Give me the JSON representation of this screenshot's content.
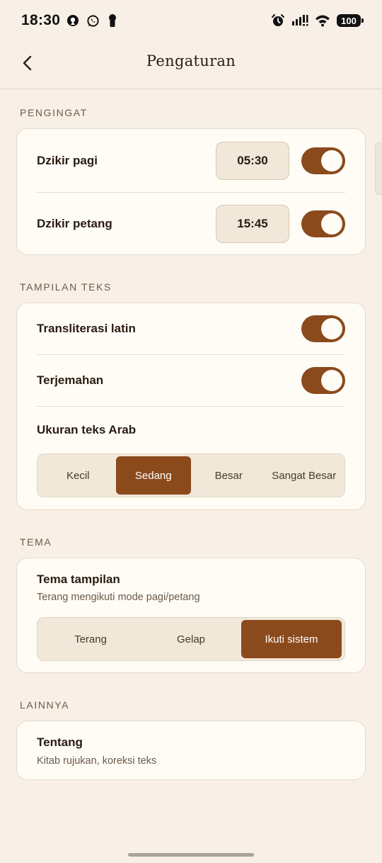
{
  "status_bar": {
    "time": "18:30",
    "battery": "100",
    "left_icons": [
      "app-icon",
      "whatsapp-icon",
      "keyhole-icon"
    ],
    "right_icons": [
      "alarm-icon",
      "signal-icon",
      "wifi-icon",
      "battery-icon"
    ]
  },
  "header": {
    "title": "Pengaturan",
    "back_icon": "chevron-left-icon"
  },
  "reminders": {
    "section_label": "PENGINGAT",
    "items": [
      {
        "label": "Dzikir pagi",
        "time": "05:30",
        "enabled": true
      },
      {
        "label": "Dzikir petang",
        "time": "15:45",
        "enabled": true
      }
    ]
  },
  "text_display": {
    "section_label": "TAMPILAN TEKS",
    "transliteration": {
      "label": "Transliterasi latin",
      "enabled": true
    },
    "translation": {
      "label": "Terjemahan",
      "enabled": true
    },
    "arabic_size": {
      "label": "Ukuran teks Arab",
      "options": [
        "Kecil",
        "Sedang",
        "Besar",
        "Sangat Besar"
      ],
      "selected": "Sedang"
    }
  },
  "theme": {
    "section_label": "TEMA",
    "title": "Tema tampilan",
    "description": "Terang mengikuti mode pagi/petang",
    "options": [
      "Terang",
      "Gelap",
      "Ikuti sistem"
    ],
    "selected": "Ikuti sistem"
  },
  "others": {
    "section_label": "LAINNYA",
    "about": {
      "title": "Tentang",
      "description": "Kitab rujukan, koreksi teks"
    }
  },
  "colors": {
    "background": "#f8f0e6",
    "card": "#fffcf6",
    "accent": "#8b4a1c",
    "text": "#2a1c10",
    "muted": "#6b5a48"
  }
}
